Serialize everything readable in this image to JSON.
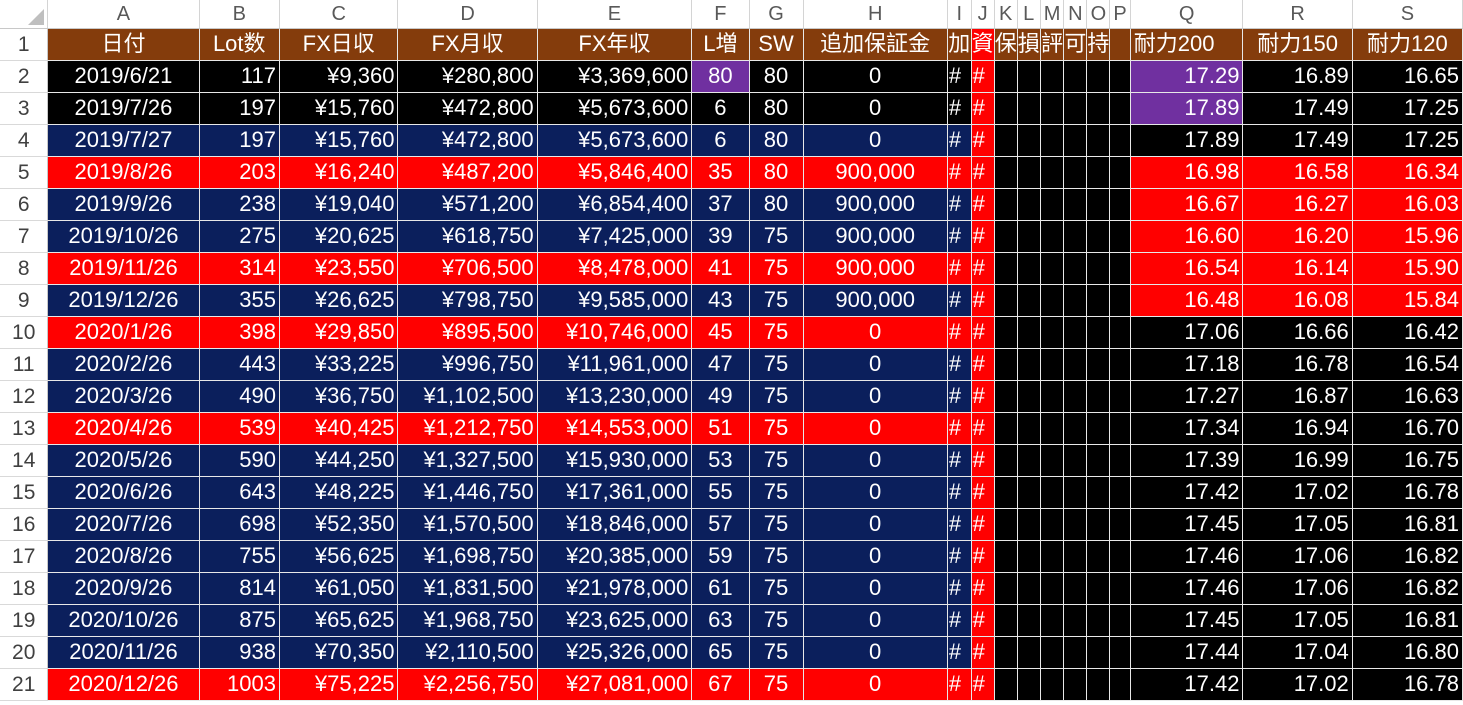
{
  "columns": [
    "A",
    "B",
    "C",
    "D",
    "E",
    "F",
    "G",
    "H",
    "I",
    "J",
    "K",
    "L",
    "M",
    "N",
    "O",
    "P",
    "Q",
    "R",
    "S"
  ],
  "header_row": {
    "row_number": "1",
    "cells": [
      "日付",
      "Lot数",
      "FX日収",
      "FX月収",
      "FX年収",
      "L増",
      "SW",
      "追加保証金",
      "加",
      "資",
      "保",
      "損",
      "評",
      "可",
      "持",
      "",
      "耐力200",
      "耐力150",
      "耐力120"
    ]
  },
  "rows": [
    {
      "n": "2",
      "band": "k",
      "cells": [
        "2019/6/21",
        "117",
        "¥9,360",
        "¥280,800",
        "¥3,369,600",
        "80",
        "80",
        "0",
        "#",
        "#",
        "17.29",
        "16.89",
        "16.65"
      ]
    },
    {
      "n": "3",
      "band": "k",
      "cells": [
        "2019/7/26",
        "197",
        "¥15,760",
        "¥472,800",
        "¥5,673,600",
        "6",
        "80",
        "0",
        "#",
        "#",
        "17.89",
        "17.49",
        "17.25"
      ]
    },
    {
      "n": "4",
      "band": "b",
      "cells": [
        "2019/7/27",
        "197",
        "¥15,760",
        "¥472,800",
        "¥5,673,600",
        "6",
        "80",
        "0",
        "#",
        "#",
        "17.89",
        "17.49",
        "17.25"
      ]
    },
    {
      "n": "5",
      "band": "r",
      "cells": [
        "2019/8/26",
        "203",
        "¥16,240",
        "¥487,200",
        "¥5,846,400",
        "35",
        "80",
        "900,000",
        "#",
        "#",
        "16.98",
        "16.58",
        "16.34"
      ]
    },
    {
      "n": "6",
      "band": "b",
      "cells": [
        "2019/9/26",
        "238",
        "¥19,040",
        "¥571,200",
        "¥6,854,400",
        "37",
        "80",
        "900,000",
        "#",
        "#",
        "16.67",
        "16.27",
        "16.03"
      ]
    },
    {
      "n": "7",
      "band": "b",
      "cells": [
        "2019/10/26",
        "275",
        "¥20,625",
        "¥618,750",
        "¥7,425,000",
        "39",
        "75",
        "900,000",
        "#",
        "#",
        "16.60",
        "16.20",
        "15.96"
      ]
    },
    {
      "n": "8",
      "band": "r",
      "cells": [
        "2019/11/26",
        "314",
        "¥23,550",
        "¥706,500",
        "¥8,478,000",
        "41",
        "75",
        "900,000",
        "#",
        "#",
        "16.54",
        "16.14",
        "15.90"
      ]
    },
    {
      "n": "9",
      "band": "b",
      "cells": [
        "2019/12/26",
        "355",
        "¥26,625",
        "¥798,750",
        "¥9,585,000",
        "43",
        "75",
        "900,000",
        "#",
        "#",
        "16.48",
        "16.08",
        "15.84"
      ]
    },
    {
      "n": "10",
      "band": "r",
      "cells": [
        "2020/1/26",
        "398",
        "¥29,850",
        "¥895,500",
        "¥10,746,000",
        "45",
        "75",
        "0",
        "#",
        "#",
        "17.06",
        "16.66",
        "16.42"
      ]
    },
    {
      "n": "11",
      "band": "b",
      "cells": [
        "2020/2/26",
        "443",
        "¥33,225",
        "¥996,750",
        "¥11,961,000",
        "47",
        "75",
        "0",
        "#",
        "#",
        "17.18",
        "16.78",
        "16.54"
      ]
    },
    {
      "n": "12",
      "band": "b",
      "cells": [
        "2020/3/26",
        "490",
        "¥36,750",
        "¥1,102,500",
        "¥13,230,000",
        "49",
        "75",
        "0",
        "#",
        "#",
        "17.27",
        "16.87",
        "16.63"
      ]
    },
    {
      "n": "13",
      "band": "r",
      "cells": [
        "2020/4/26",
        "539",
        "¥40,425",
        "¥1,212,750",
        "¥14,553,000",
        "51",
        "75",
        "0",
        "#",
        "#",
        "17.34",
        "16.94",
        "16.70"
      ]
    },
    {
      "n": "14",
      "band": "b",
      "cells": [
        "2020/5/26",
        "590",
        "¥44,250",
        "¥1,327,500",
        "¥15,930,000",
        "53",
        "75",
        "0",
        "#",
        "#",
        "17.39",
        "16.99",
        "16.75"
      ]
    },
    {
      "n": "15",
      "band": "b",
      "cells": [
        "2020/6/26",
        "643",
        "¥48,225",
        "¥1,446,750",
        "¥17,361,000",
        "55",
        "75",
        "0",
        "#",
        "#",
        "17.42",
        "17.02",
        "16.78"
      ]
    },
    {
      "n": "16",
      "band": "b",
      "cells": [
        "2020/7/26",
        "698",
        "¥52,350",
        "¥1,570,500",
        "¥18,846,000",
        "57",
        "75",
        "0",
        "#",
        "#",
        "17.45",
        "17.05",
        "16.81"
      ]
    },
    {
      "n": "17",
      "band": "b",
      "cells": [
        "2020/8/26",
        "755",
        "¥56,625",
        "¥1,698,750",
        "¥20,385,000",
        "59",
        "75",
        "0",
        "#",
        "#",
        "17.46",
        "17.06",
        "16.82"
      ]
    },
    {
      "n": "18",
      "band": "b",
      "cells": [
        "2020/9/26",
        "814",
        "¥61,050",
        "¥1,831,500",
        "¥21,978,000",
        "61",
        "75",
        "0",
        "#",
        "#",
        "17.46",
        "17.06",
        "16.82"
      ]
    },
    {
      "n": "19",
      "band": "b",
      "cells": [
        "2020/10/26",
        "875",
        "¥65,625",
        "¥1,968,750",
        "¥23,625,000",
        "63",
        "75",
        "0",
        "#",
        "#",
        "17.45",
        "17.05",
        "16.81"
      ]
    },
    {
      "n": "20",
      "band": "b",
      "cells": [
        "2020/11/26",
        "938",
        "¥70,350",
        "¥2,110,500",
        "¥25,326,000",
        "65",
        "75",
        "0",
        "#",
        "#",
        "17.44",
        "17.04",
        "16.80"
      ]
    },
    {
      "n": "21",
      "band": "r",
      "cells": [
        "2020/12/26",
        "1003",
        "¥75,225",
        "¥2,256,750",
        "¥27,081,000",
        "67",
        "75",
        "0",
        "#",
        "#",
        "17.42",
        "17.02",
        "16.78"
      ]
    }
  ],
  "colors": {
    "header_brown": "#843c0c",
    "band_navy": "#0b1f5c",
    "band_red": "#ff0000",
    "band_black": "#000000",
    "highlight_purple": "#7030a0"
  }
}
